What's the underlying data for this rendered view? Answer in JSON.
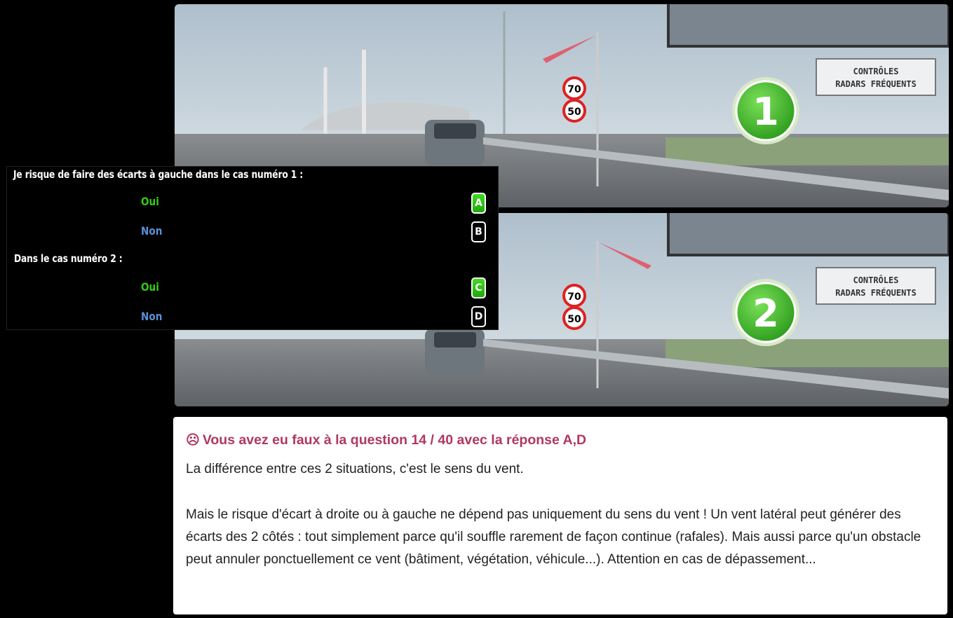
{
  "photos": [
    {
      "badge": "1",
      "sign_line1": "CONTRÔLES",
      "sign_line2": "RADARS FRÉQUENTS",
      "speed1": "70",
      "speed2": "50"
    },
    {
      "badge": "2",
      "sign_line1": "CONTRÔLES",
      "sign_line2": "RADARS FRÉQUENTS",
      "speed1": "70",
      "speed2": "50"
    }
  ],
  "quiz": {
    "question1": "Je risque de faire des écarts à gauche dans le cas numéro 1 :",
    "question2": "Dans le cas numéro 2 :",
    "options": [
      {
        "label": "Oui",
        "key": "A",
        "selected": true
      },
      {
        "label": "Non",
        "key": "B",
        "selected": false
      },
      {
        "label": "Oui",
        "key": "C",
        "selected": true
      },
      {
        "label": "Non",
        "key": "D",
        "selected": false
      }
    ]
  },
  "feedback": {
    "icon": "☹",
    "title": "Vous avez eu faux à la question 14 / 40 avec la réponse A,D",
    "para1": "La différence entre ces 2 situations, c'est le sens du vent.",
    "para2": "Mais le risque d'écart à droite ou à gauche ne dépend pas uniquement du sens du vent ! Un vent latéral peut générer des écarts des 2 côtés : tout simplement parce qu'il souffle rarement de façon continue (rafales). Mais aussi parce qu'un obstacle peut annuler ponctuellement ce vent (bâtiment, végétation, véhicule...). Attention en cas de dépassement..."
  },
  "colors": {
    "accent_title": "#b03860",
    "yes": "#33cc14",
    "no": "#5b8fd6",
    "badge_green": "#3cb82a"
  }
}
